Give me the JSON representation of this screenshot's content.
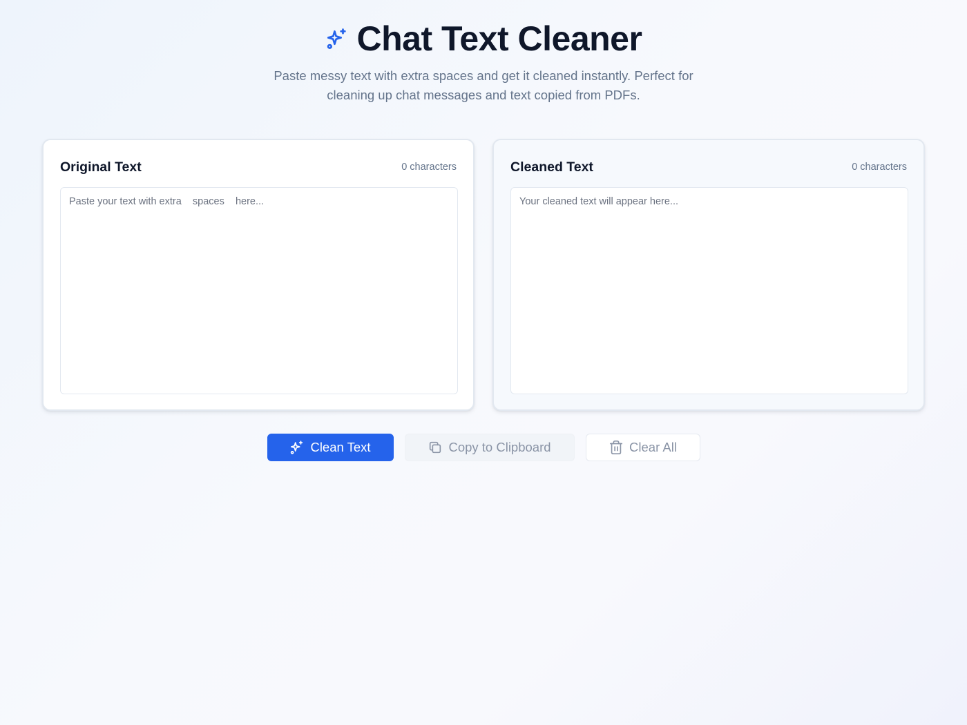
{
  "header": {
    "title": "Chat Text Cleaner",
    "subtitle": "Paste messy text with extra spaces and get it cleaned instantly. Perfect for cleaning up chat messages and text copied from PDFs.",
    "icon": "sparkles-icon"
  },
  "original": {
    "title": "Original Text",
    "count": "0 characters",
    "value": "",
    "placeholder": "Paste your text with extra    spaces    here..."
  },
  "cleaned": {
    "title": "Cleaned Text",
    "count": "0 characters",
    "value": "",
    "placeholder": "Your cleaned text will appear here..."
  },
  "actions": {
    "clean_label": "Clean Text",
    "copy_label": "Copy to Clipboard",
    "clear_label": "Clear All"
  },
  "colors": {
    "primary": "#2563eb",
    "title": "#0f172a",
    "muted": "#64748b"
  }
}
